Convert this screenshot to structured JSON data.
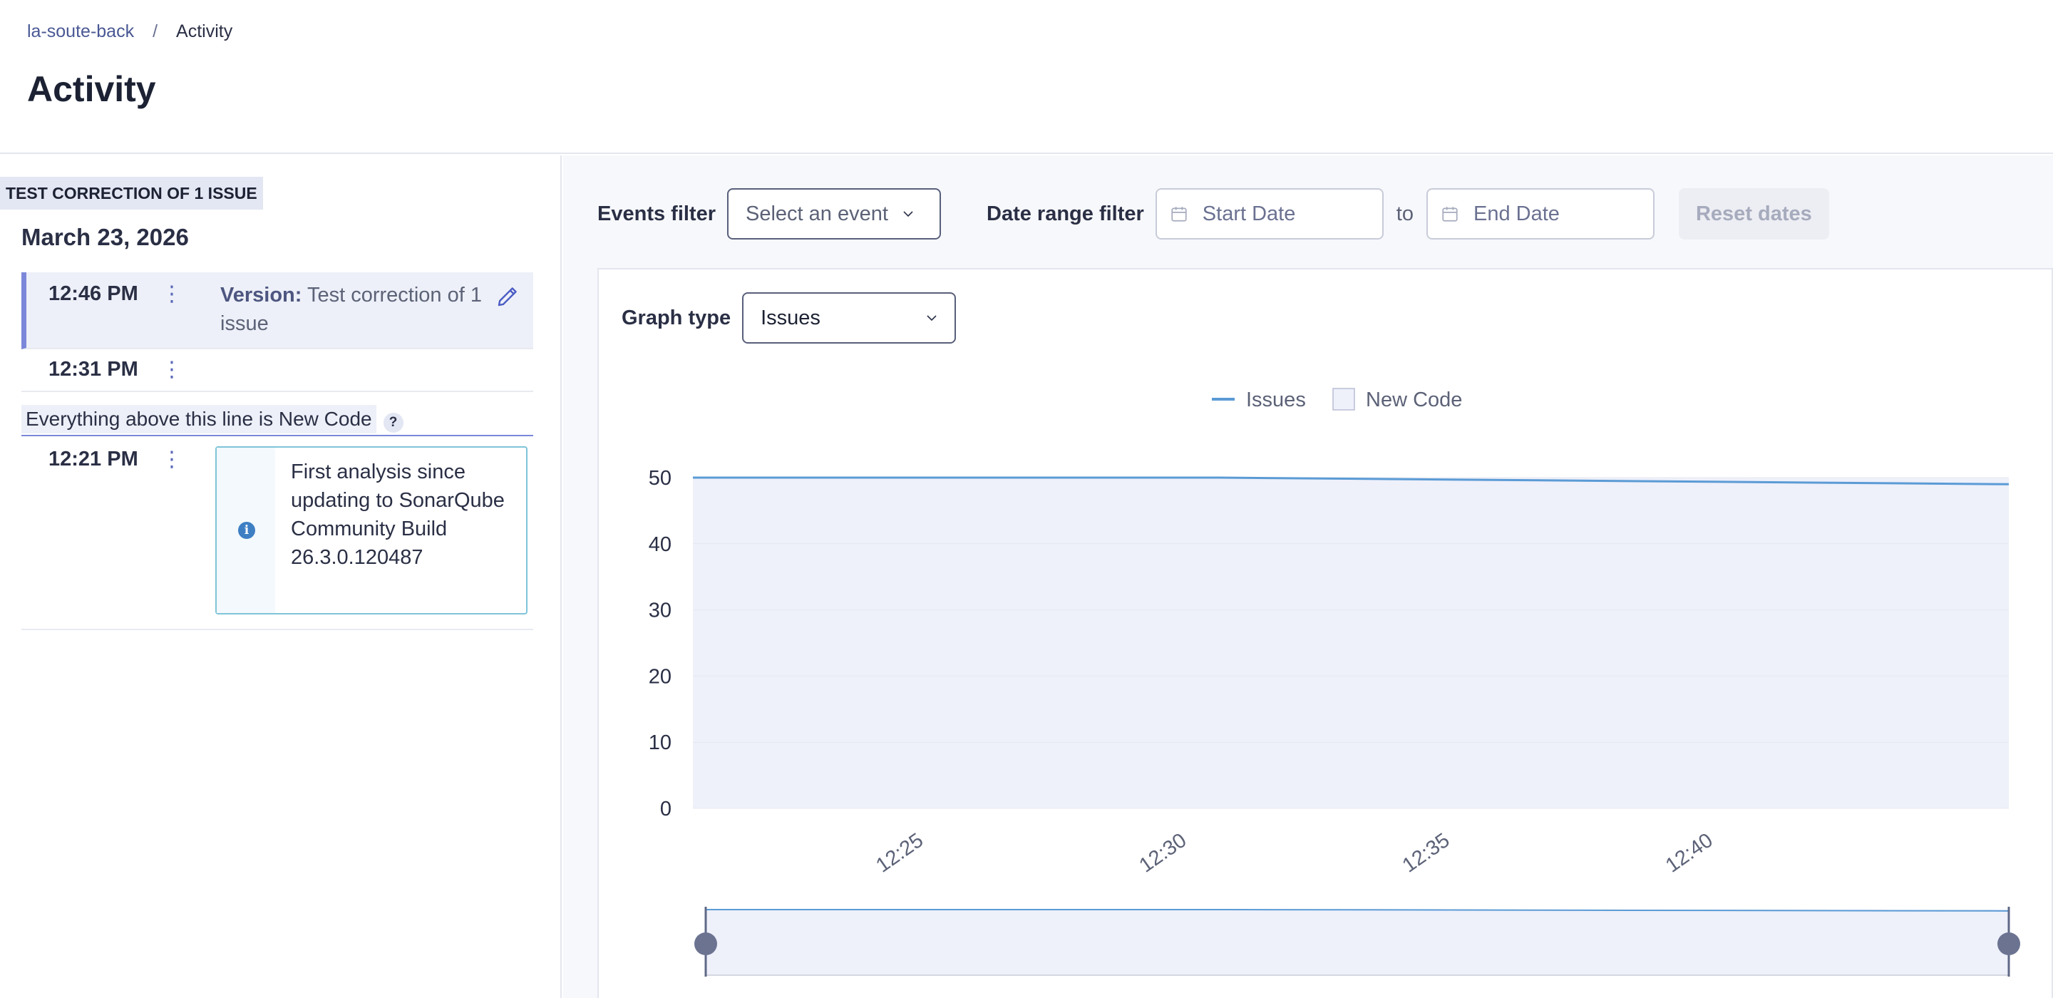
{
  "breadcrumb": {
    "project": "la-soute-back",
    "separator": "/",
    "current": "Activity"
  },
  "page_title": "Activity",
  "history": {
    "version_tag": "TEST CORRECTION OF 1 ISSUE",
    "date": "March 23, 2026",
    "events": [
      {
        "time": "12:46 PM",
        "menu": "⋮",
        "label": "Version:",
        "text": "Test correction of 1 issue",
        "selected": true
      },
      {
        "time": "12:31 PM",
        "menu": "⋮"
      },
      {
        "time": "12:21 PM",
        "menu": "⋮",
        "info": "First analysis since updating to SonarQube Community Build 26.3.0.120487"
      }
    ],
    "new_code_label": "Everything above this line is New Code",
    "help_glyph": "?",
    "info_glyph": "i"
  },
  "filters": {
    "events_label": "Events filter",
    "events_value": "Select an event",
    "date_label": "Date range filter",
    "start_placeholder": "Start Date",
    "to": "to",
    "end_placeholder": "End Date",
    "reset": "Reset dates"
  },
  "graph": {
    "type_label": "Graph type",
    "type_value": "Issues"
  },
  "colors": {
    "issues_line": "#5b9bd5",
    "new_code_fill": "#eef0fa",
    "accent": "#7b87d9"
  },
  "chart_data": {
    "type": "line",
    "legend": [
      {
        "name": "Issues",
        "kind": "line"
      },
      {
        "name": "New Code",
        "kind": "area"
      }
    ],
    "legend_position": "top-center",
    "series": [
      {
        "name": "Issues",
        "x": [
          "12:21",
          "12:31",
          "12:46"
        ],
        "values": [
          50,
          50,
          49
        ]
      }
    ],
    "x_ticks": [
      "12:25",
      "12:30",
      "12:35",
      "12:40"
    ],
    "y_ticks": [
      0,
      10,
      20,
      30,
      40,
      50
    ],
    "ylim": [
      0,
      50
    ],
    "xlim": [
      "12:21",
      "12:46"
    ],
    "new_code_range": [
      "12:21",
      "12:46"
    ],
    "grid": true
  }
}
